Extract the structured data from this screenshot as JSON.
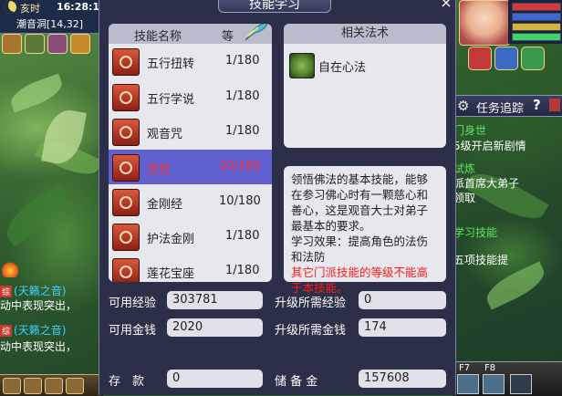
{
  "hud": {
    "time_label": "亥时",
    "time_value": "16:28:1",
    "location": "潮音洞[14,32]"
  },
  "chat": [
    {
      "tag": "综",
      "text": "(天籁之音)",
      "color": "#3cd0ff"
    },
    {
      "tag": "",
      "text": "动中表现突出，",
      "color": "#ffffff"
    },
    {
      "tag": "综",
      "text": "(天籁之音)",
      "color": "#3cd0ff"
    },
    {
      "tag": "",
      "text": "动中表现突出，",
      "color": "#ffffff"
    }
  ],
  "quest": {
    "title": "任务追踪",
    "help": "?",
    "lines": [
      {
        "text": "门身世",
        "color": "#5fe35f"
      },
      {
        "text": "5级开启新剧情",
        "color": "#ffffff"
      },
      {
        "text": "试炼",
        "color": "#5fe35f"
      },
      {
        "text": "派首席大弟子",
        "color": "#ffffff"
      },
      {
        "text": "领取",
        "color": "#ffffff"
      },
      {
        "text": "学习技能",
        "color": "#5fe35f"
      },
      {
        "text": "五项技能提",
        "color": "#ffffff"
      }
    ],
    "fkeys": [
      "F7",
      "F8"
    ]
  },
  "dialog": {
    "title": "技能学习",
    "close": "×",
    "skill_header": {
      "name": "技能名称",
      "level": "等"
    },
    "skills": [
      {
        "name": "五行扭转",
        "level": "1/180",
        "selected": false
      },
      {
        "name": "五行学说",
        "level": "1/180",
        "selected": false
      },
      {
        "name": "观音咒",
        "level": "1/180",
        "selected": false
      },
      {
        "name": "灵性",
        "level": "10/180",
        "selected": true
      },
      {
        "name": "金刚经",
        "level": "10/180",
        "selected": false
      },
      {
        "name": "护法金刚",
        "level": "1/180",
        "selected": false
      },
      {
        "name": "莲花宝座",
        "level": "1/180",
        "selected": false
      }
    ],
    "spell_header": "相关法术",
    "spells": [
      {
        "name": "自在心法"
      }
    ],
    "description": "领悟佛法的基本技能，能够在参习佛心时有一颗慈心和善心，这是观音大士对弟子最基本的要求。",
    "effect": "学习效果：提高角色的法伤和法防",
    "warning": "其它门派技能的等级不能高于本技能。",
    "stats": {
      "exp_label": "可用经验",
      "exp_value": "303781",
      "need_exp_label": "升级所需经验",
      "need_exp_value": "0",
      "money_label": "可用金钱",
      "money_value": "2020",
      "need_money_label": "升级所需金钱",
      "need_money_value": "174",
      "deposit_label": "存　款",
      "deposit_value": "0",
      "reserve_label": "储 备 金",
      "reserve_value": "157608"
    }
  },
  "colors": {
    "panel_bg": "#2b2f47",
    "selected_row": "#5f5fcf",
    "selected_text": "#ff3030",
    "warning_text": "#ff1a1a"
  }
}
